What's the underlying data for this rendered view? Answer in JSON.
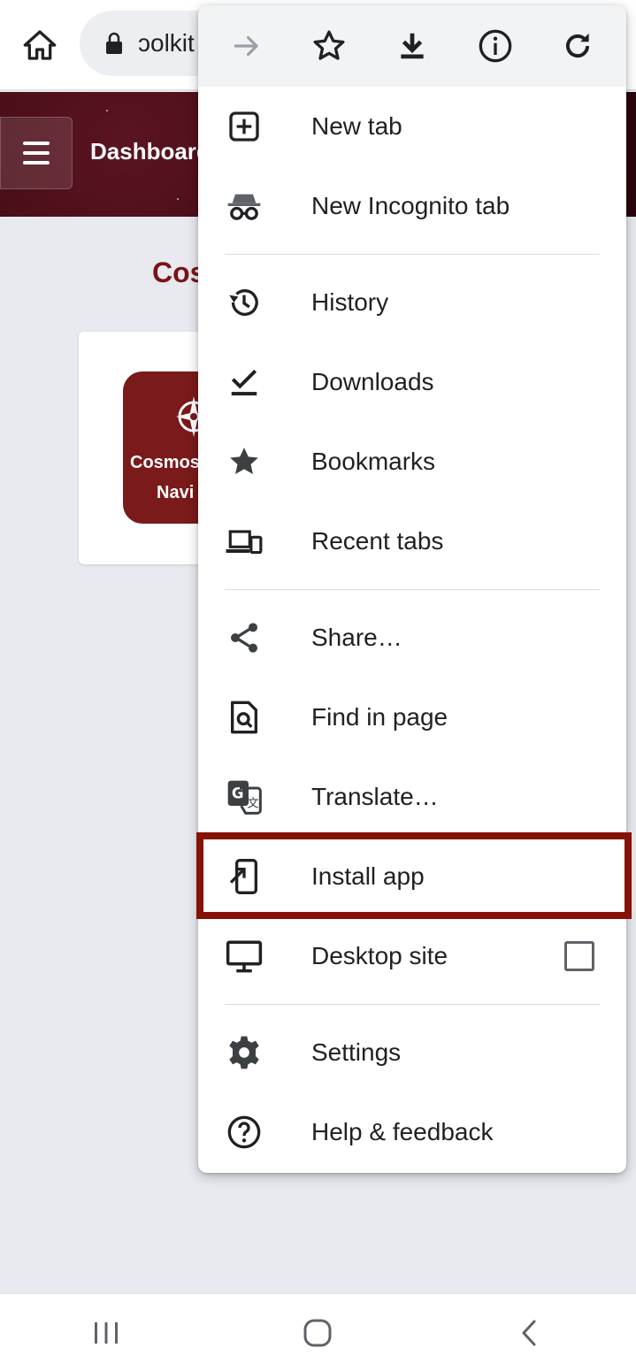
{
  "browser": {
    "url_text": "ɔolkit",
    "icons": {
      "home": "home-icon",
      "lock": "lock-icon"
    }
  },
  "page": {
    "banner_title": "Dashboard",
    "heading": "Cos",
    "app_tile": {
      "line1": "Cosmos",
      "line2": "Navi"
    }
  },
  "menu": {
    "top_actions": [
      {
        "name": "forward-icon"
      },
      {
        "name": "bookmark-star-icon"
      },
      {
        "name": "download-icon"
      },
      {
        "name": "info-icon"
      },
      {
        "name": "reload-icon"
      }
    ],
    "items": {
      "new_tab": "New tab",
      "new_incognito_tab": "New Incognito tab",
      "history": "History",
      "downloads": "Downloads",
      "bookmarks": "Bookmarks",
      "recent_tabs": "Recent tabs",
      "share": "Share…",
      "find_in_page": "Find in page",
      "translate": "Translate…",
      "install_app": "Install app",
      "desktop_site": "Desktop site",
      "settings": "Settings",
      "help_feedback": "Help & feedback"
    },
    "desktop_site_checked": false,
    "highlight_color": "#861207"
  },
  "navbar": {
    "buttons": [
      "recents-icon",
      "home-icon",
      "back-icon"
    ]
  }
}
